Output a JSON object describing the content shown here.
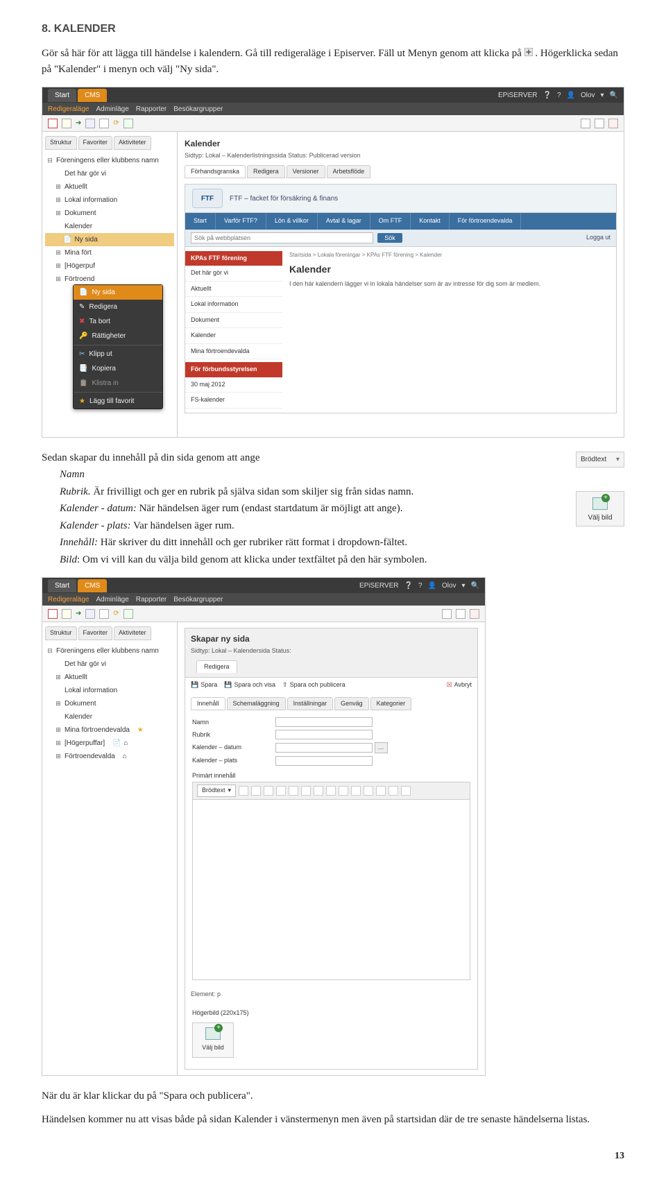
{
  "section": {
    "title": "8. KALENDER"
  },
  "intro": {
    "p1a": "Gör så här för att lägga till händelse i kalendern. Gå till redigeraläge i Episerver. Fäll ut Menyn genom att klicka på ",
    "p1b": ". Högerklicka sedan på \"Kalender\" i menyn och välj \"Ny sida\"."
  },
  "s1": {
    "top": {
      "start": "Start",
      "cms": "CMS",
      "brand": "EPiSERVER",
      "user": "Olov"
    },
    "bar2": {
      "a": "Redigeraläge",
      "b": "Adminläge",
      "c": "Rapporter",
      "d": "Besökargrupper"
    },
    "lefttabs": {
      "a": "Struktur",
      "b": "Favoriter",
      "c": "Aktiviteter"
    },
    "tree": {
      "root": "Föreningens eller klubbens namn",
      "items": [
        "Det här gör vi",
        "Aktuellt",
        "Lokal information",
        "Dokument",
        "Kalender",
        "Mina fört",
        "[Högerpuf",
        "Förtroend"
      ],
      "nySida": "Ny sida"
    },
    "ctx": {
      "items": [
        "Ny sida",
        "Redigera",
        "Ta bort",
        "Rättigheter",
        "Klipp ut",
        "Kopiera",
        "Klistra in",
        "Lägg till favorit"
      ]
    },
    "main": {
      "title": "Kalender",
      "sidtyp": "Sidtyp: Lokal – Kalenderlistningssida   Status: Publicerad version",
      "tabs": [
        "Förhandsgranska",
        "Redigera",
        "Versioner",
        "Arbetsflöde"
      ]
    },
    "pv": {
      "slogan": "FTF – facket för försäkring & finans",
      "nav": [
        "Start",
        "Varför FTF?",
        "Lön & villkor",
        "Avtal & lagar",
        "Om FTF",
        "Kontakt",
        "För förtroendevalda"
      ],
      "searchPh": "Sök på webbplatsen",
      "sok": "Sök",
      "logga": "Logga ut",
      "sideHead": "KPAs FTF förening",
      "sideItems": [
        "Det här gör vi",
        "Aktuellt",
        "Lokal information",
        "Dokument",
        "Kalender",
        "Mina förtroendevalda"
      ],
      "sideHead2": "För förbundsstyrelsen",
      "sideItems2": [
        "30 maj 2012",
        "FS-kalender"
      ],
      "bc": "Startsida > Lokala föreningar > KPAs FTF förening > Kalender",
      "pvt": "Kalender",
      "pvd": "I den här kalendern lägger vi in lokala händelser som är av intresse för dig som är medlem."
    }
  },
  "mid": {
    "p1": "Sedan skapar du innehåll på din sida genom att ange",
    "namn": "Namn",
    "rubrik_i": "Rubrik.",
    "rubrik_t": " Är frivilligt och ger en rubrik på själva sidan som skiljer sig från sidas namn.",
    "kd_i": "Kalender - datum:",
    "kd_t": " När händelsen äger rum (endast startdatum är möjligt att ange).",
    "kp_i": "Kalender - plats:",
    "kp_t": " Var händelsen äger rum.",
    "inn_i": "Innehåll:",
    "inn_t": " Här skriver du ditt innehåll och ger rubriker rätt format i dropdown-fältet.",
    "bild_i": "Bild",
    "bild_t": ": Om vi vill kan du välja bild genom att klicka under textfältet på den här symbolen."
  },
  "side": {
    "brodtext": "Brödtext",
    "valjbild": "Välj bild"
  },
  "s2": {
    "tree": {
      "root": "Föreningens eller klubbens namn",
      "items": [
        "Det här gör vi",
        "Aktuellt",
        "Lokal information",
        "Dokument",
        "Kalender",
        "Mina förtroendevalda",
        "[Högerpuffar]",
        "Förtroendevalda"
      ]
    },
    "head": {
      "title": "Skapar ny sida",
      "sub": "Sidtyp: Lokal – Kalendersida   Status:"
    },
    "redigera": "Redigera",
    "actions": {
      "spara": "Spara",
      "sov": "Spara och visa",
      "sop": "Spara och publicera",
      "avbryt": "Avbryt"
    },
    "subtabs": [
      "Innehåll",
      "Schemaläggning",
      "Inställningar",
      "Genväg",
      "Kategorier"
    ],
    "form": {
      "namn": "Namn",
      "rubrik": "Rubrik",
      "kdatum": "Kalender – datum",
      "kplats": "Kalender – plats",
      "pinn": "Primärt innehåll"
    },
    "rte": {
      "dd": "Brödtext"
    },
    "element": "Element: p",
    "hogerbild": "Högerbild (220x175)",
    "valjbild": "Välj bild"
  },
  "outro": {
    "p1": "När du är klar klickar du på \"Spara och publicera\".",
    "p2": "Händelsen kommer nu att visas både på sidan Kalender i vänstermenyn men även på startsidan där de tre senaste händelserna listas."
  },
  "pageNum": "13"
}
